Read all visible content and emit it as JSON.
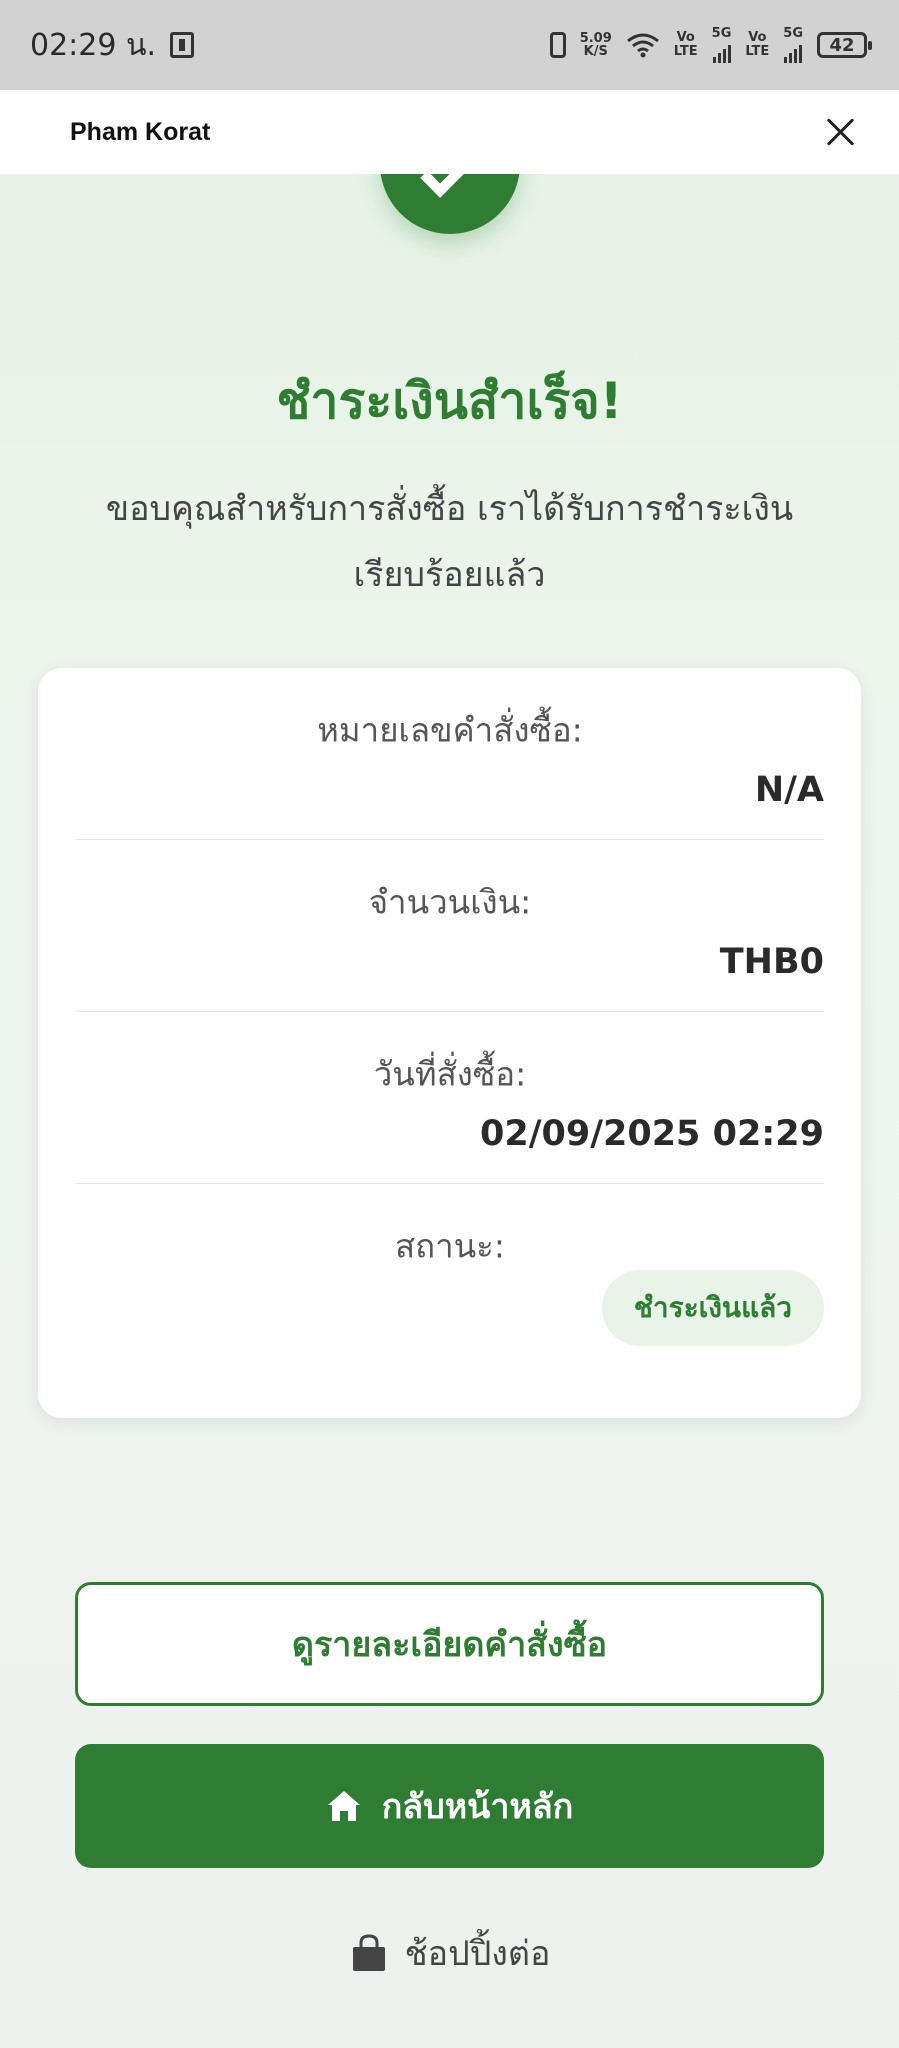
{
  "status_bar": {
    "time": "02:29 น.",
    "net_speed_value": "5.09",
    "net_speed_unit": "K/S",
    "sim1_label_top": "Vo",
    "sim1_label_bottom": "LTE",
    "sim1_gen": "5G",
    "sim2_label_top": "Vo",
    "sim2_label_bottom": "LTE",
    "sim2_gen": "5G",
    "battery": "42"
  },
  "app_bar": {
    "title": "Pham Korat"
  },
  "result": {
    "title": "ชำระเงินสำเร็จ!",
    "description": "ขอบคุณสำหรับการสั่งซื้อ เราได้รับการชำระเงินเรียบร้อยแล้ว"
  },
  "order_card": {
    "order_number_label": "หมายเลขคำสั่งซื้อ:",
    "order_number_value": "N/A",
    "amount_label": "จำนวนเงิน:",
    "amount_value": "THB0",
    "order_date_label": "วันที่สั่งซื้อ:",
    "order_date_value": "02/09/2025 02:29",
    "status_label": "สถานะ:",
    "status_value": "ชำระเงินแล้ว"
  },
  "actions": {
    "view_order_label": "ดูรายละเอียดคำสั่งซื้อ",
    "home_label": "กลับหน้าหลัก",
    "continue_shopping_label": "ช้อปปิ้งต่อ"
  },
  "colors": {
    "primary_green": "#2e7d32",
    "badge_bg": "#e7f4e7"
  },
  "icons": {
    "close": "close-icon",
    "check": "check-icon",
    "home": "home-icon",
    "bag": "shopping-bag-icon"
  }
}
